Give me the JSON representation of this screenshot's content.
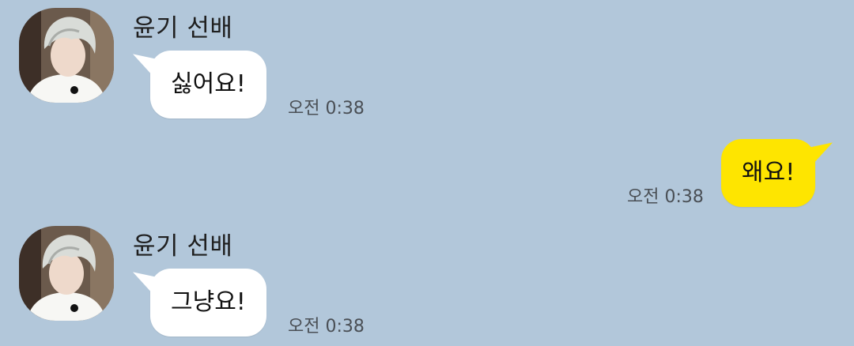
{
  "chat": {
    "messages": [
      {
        "sender": "윤기 선배",
        "text": "싫어요!",
        "time": "오전 0:38",
        "direction": "incoming"
      },
      {
        "text": "왜요!",
        "time": "오전 0:38",
        "direction": "outgoing"
      },
      {
        "sender": "윤기 선배",
        "text": "그냥요!",
        "time": "오전 0:38",
        "direction": "incoming"
      }
    ]
  },
  "colors": {
    "background": "#b2c7da",
    "incoming_bubble": "#ffffff",
    "outgoing_bubble": "#fee500"
  }
}
